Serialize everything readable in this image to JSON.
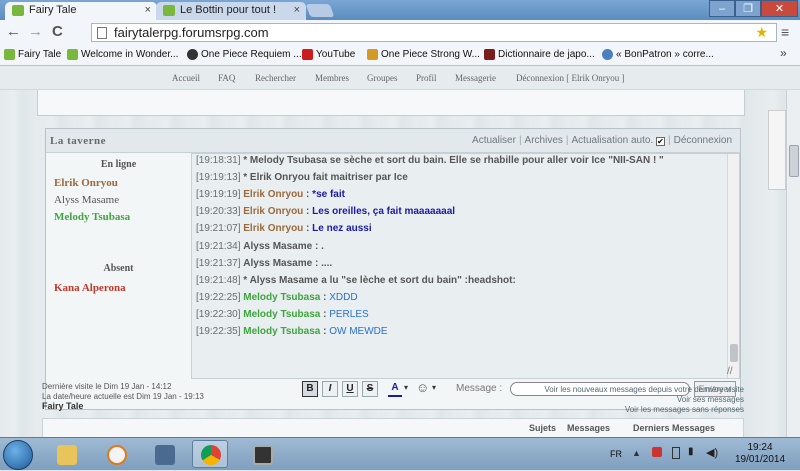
{
  "browser": {
    "tabs": [
      {
        "label": "Fairy Tale"
      },
      {
        "label": "Le Bottin pour tout !"
      }
    ],
    "window_controls": [
      "–",
      "❐",
      "✕"
    ],
    "nav": {
      "back": "←",
      "forward": "→",
      "reload": "C"
    },
    "url": "fairytalerpg.forumsrpg.com",
    "menu_icon": "≡",
    "bookmarks": [
      {
        "label": "Fairy Tale"
      },
      {
        "label": "Welcome in Wonder..."
      },
      {
        "label": "One Piece Requiem ..."
      },
      {
        "label": "YouTube"
      },
      {
        "label": "One Piece Strong W..."
      },
      {
        "label": "Dictionnaire de japo..."
      },
      {
        "label": "« BonPatron » corre..."
      }
    ],
    "bookmarks_more": "»"
  },
  "site_nav": [
    "Accueil",
    "FAQ",
    "Rechercher",
    "Membres",
    "Groupes",
    "Profil",
    "Messagerie",
    "Déconnexion [ Elrik Onryou ]"
  ],
  "chatbox": {
    "title": "La taverne",
    "actions": {
      "actualiser": "Actualiser",
      "archives": "Archives",
      "auto": "Actualisation auto.",
      "auto_checked": "✔",
      "deconnexion": "Déconnexion"
    },
    "online_label": "En ligne",
    "absent_label": "Absent",
    "online_users": [
      {
        "name": "Elrik Onryou",
        "color": "#9b6a3c"
      },
      {
        "name": "Alyss Masame",
        "color": "#555555"
      },
      {
        "name": "Melody Tsubasa",
        "color": "#3fa53f"
      }
    ],
    "absent_users": [
      {
        "name": "Kana Alperona",
        "color": "#c0392b"
      }
    ],
    "messages": [
      {
        "time": "[19:18:31]",
        "author": "",
        "text": "* Melody Tsubasa se sèche et sort du bain. Elle se rhabille pour aller voir Ice \"NII-SAN ! \"",
        "author_color": "#555555",
        "text_color": "#555555"
      },
      {
        "time": "[19:19:13]",
        "author": "",
        "text": "* Elrik Onryou fait maitriser par Ice",
        "author_color": "#555555",
        "text_color": "#555555"
      },
      {
        "time": "[19:19:19]",
        "author": "Elrik Onryou",
        "text": "*se fait",
        "author_color": "#9b6a3c",
        "text_color": "#1a1aa8"
      },
      {
        "time": "[19:20:33]",
        "author": "Elrik Onryou",
        "text": "Les oreilles, ça fait maaaaaaal",
        "author_color": "#9b6a3c",
        "text_color": "#1a1aa8"
      },
      {
        "time": "[19:21:07]",
        "author": "Elrik Onryou",
        "text": "Le nez aussi",
        "author_color": "#9b6a3c",
        "text_color": "#1a1aa8"
      },
      {
        "time": "[19:21:34]",
        "author": "Alyss Masame",
        "text": ".",
        "author_color": "#555555",
        "text_color": "#555555"
      },
      {
        "time": "[19:21:37]",
        "author": "Alyss Masame",
        "text": "....",
        "author_color": "#555555",
        "text_color": "#555555"
      },
      {
        "time": "[19:21:48]",
        "author": "",
        "text": "* Alyss Masame a lu \"se lèche et sort du bain\" :headshot:",
        "author_color": "#555555",
        "text_color": "#555555"
      },
      {
        "time": "[19:22:25]",
        "author": "Melody Tsubasa",
        "text": "XDDD",
        "author_color": "#3fa53f",
        "text_color": "#2a6fd6"
      },
      {
        "time": "[19:22:30]",
        "author": "Melody Tsubasa",
        "text": "PERLES",
        "author_color": "#3fa53f",
        "text_color": "#2a6fd6"
      },
      {
        "time": "[19:22:35]",
        "author": "Melody Tsubasa",
        "text": "OW MEWDE",
        "author_color": "#3fa53f",
        "text_color": "#2a6fd6"
      }
    ],
    "format_buttons": [
      "B",
      "I",
      "U",
      "S"
    ],
    "color_button": "A",
    "emoji_button": "☺",
    "dropdown_arrow": "▾",
    "message_label": "Message :",
    "message_value": "",
    "send_label": "Envoyer",
    "resize_icon": "//"
  },
  "footer": {
    "last_visit": "Dernière visite le Dim 19 Jan - 14:12",
    "current_time": "La date/heure actuelle est Dim 19 Jan - 19:13",
    "forum_name": "Fairy Tale",
    "links": [
      "Voir les nouveaux messages depuis votre dernière visite",
      "Voir ses messages",
      "Voir les messages sans réponses"
    ]
  },
  "bottom_strip": {
    "left": "Sujets",
    "mid": "Messages",
    "right": "Derniers Messages"
  },
  "taskbar": {
    "lang": "FR",
    "time": "19:24",
    "date": "19/01/2014"
  },
  "colors": {
    "elrik": "#9b6a3c",
    "melody": "#3fa53f",
    "kana": "#c0392b",
    "alyss": "#555555"
  }
}
